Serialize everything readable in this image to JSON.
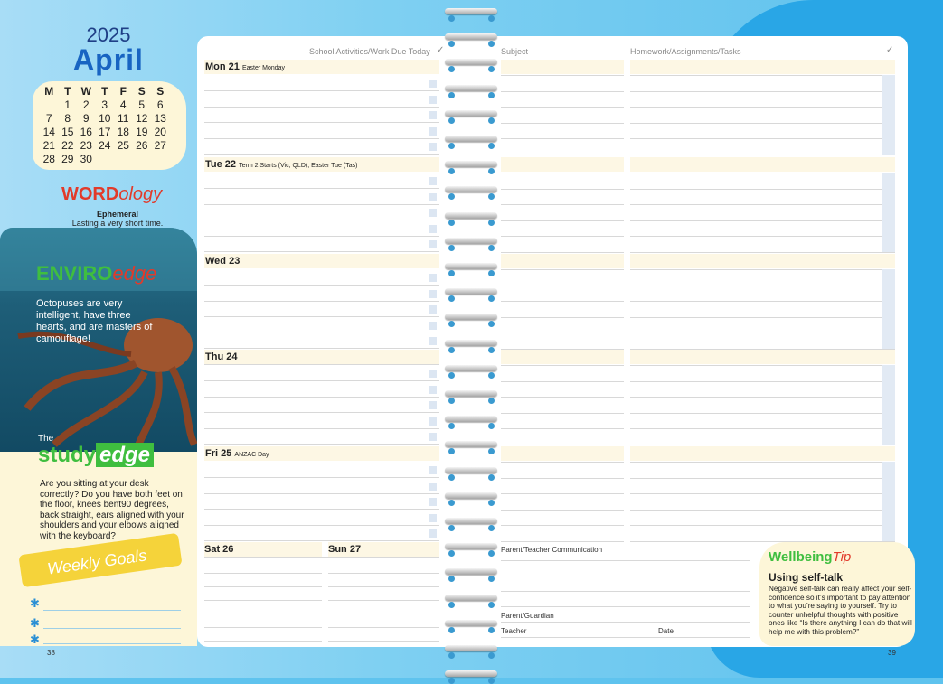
{
  "calendar": {
    "year": "2025",
    "month": "April",
    "weekdays": [
      "M",
      "T",
      "W",
      "T",
      "F",
      "S",
      "S"
    ],
    "weeks": [
      [
        "",
        "1",
        "2",
        "3",
        "4",
        "5",
        "6"
      ],
      [
        "7",
        "8",
        "9",
        "10",
        "11",
        "12",
        "13"
      ],
      [
        "14",
        "15",
        "16",
        "17",
        "18",
        "19",
        "20"
      ],
      [
        "21",
        "22",
        "23",
        "24",
        "25",
        "26",
        "27"
      ],
      [
        "28",
        "29",
        "30",
        "",
        "",
        "",
        ""
      ]
    ]
  },
  "wordology": {
    "hi": "WORD",
    "lo": "ology",
    "word": "Ephemeral",
    "definition": "Lasting a very short time."
  },
  "enviro": {
    "hi": "ENVIRO",
    "lo": "edge",
    "text": "Octopuses are very intelligent, have three hearts, and are masters of camouflage!"
  },
  "study": {
    "the": "The",
    "hi": "study",
    "lo": "edge",
    "text": "Are you sitting at your desk correctly? Do you have both feet on the floor, knees bent90 degrees, back straight, ears aligned with your shoulders and your elbows aligned with the keyboard?"
  },
  "goals": {
    "title": "Weekly Goals",
    "star": "✱"
  },
  "headers": {
    "school": "School Activities/Work Due Today",
    "subject": "Subject",
    "homework": "Homework/Assignments/Tasks",
    "check": "✓"
  },
  "days": [
    {
      "label": "Mon 21",
      "note": "Easter Monday"
    },
    {
      "label": "Tue 22",
      "note": "Term 2 Starts (Vic, QLD), Easter Tue (Tas)"
    },
    {
      "label": "Wed 23",
      "note": ""
    },
    {
      "label": "Thu 24",
      "note": ""
    },
    {
      "label": "Fri 25",
      "note": "ANZAC Day"
    }
  ],
  "weekend": {
    "sat": "Sat 26",
    "sun": "Sun 27"
  },
  "communication": {
    "title": "Parent/Teacher Communication",
    "parent": "Parent/Guardian",
    "teacher": "Teacher",
    "date": "Date"
  },
  "wellbeing": {
    "hi": "Wellbeing",
    "lo": "Tip",
    "title": "Using self-talk",
    "text": "Negative self-talk can really affect your self-confidence so it’s important to pay attention to what you’re saying to yourself. Try to counter unhelpful thoughts with positive ones like “Is there anything I can do that will help me with this problem?”"
  },
  "pages": {
    "left": "38",
    "right": "39"
  }
}
